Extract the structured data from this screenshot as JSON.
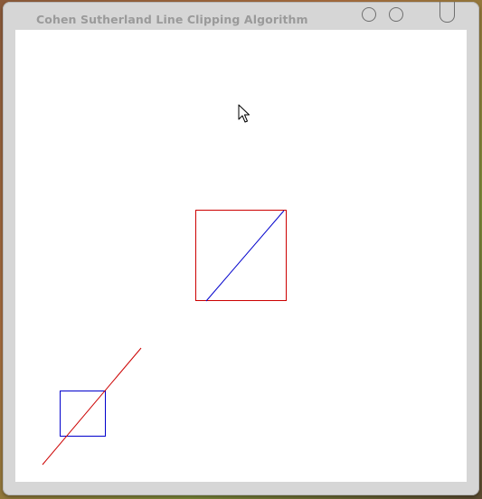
{
  "window": {
    "title": "Cohen Sutherland Line Clipping Algorithm",
    "controls": [
      "minimize-button",
      "maximize-button",
      "close-button"
    ]
  },
  "scene": {
    "clip_window_main": {
      "color": "#cc0000"
    },
    "clipped_line": {
      "color": "#0000cc"
    },
    "clip_window_small": {
      "color": "#0000cc"
    },
    "original_line": {
      "color": "#cc0000"
    },
    "cursor": "mouse-pointer-icon"
  },
  "colors": {
    "red": "#cc0000",
    "blue": "#0000cc",
    "canvas": "#ffffff",
    "frame": "#d6d6d6"
  }
}
